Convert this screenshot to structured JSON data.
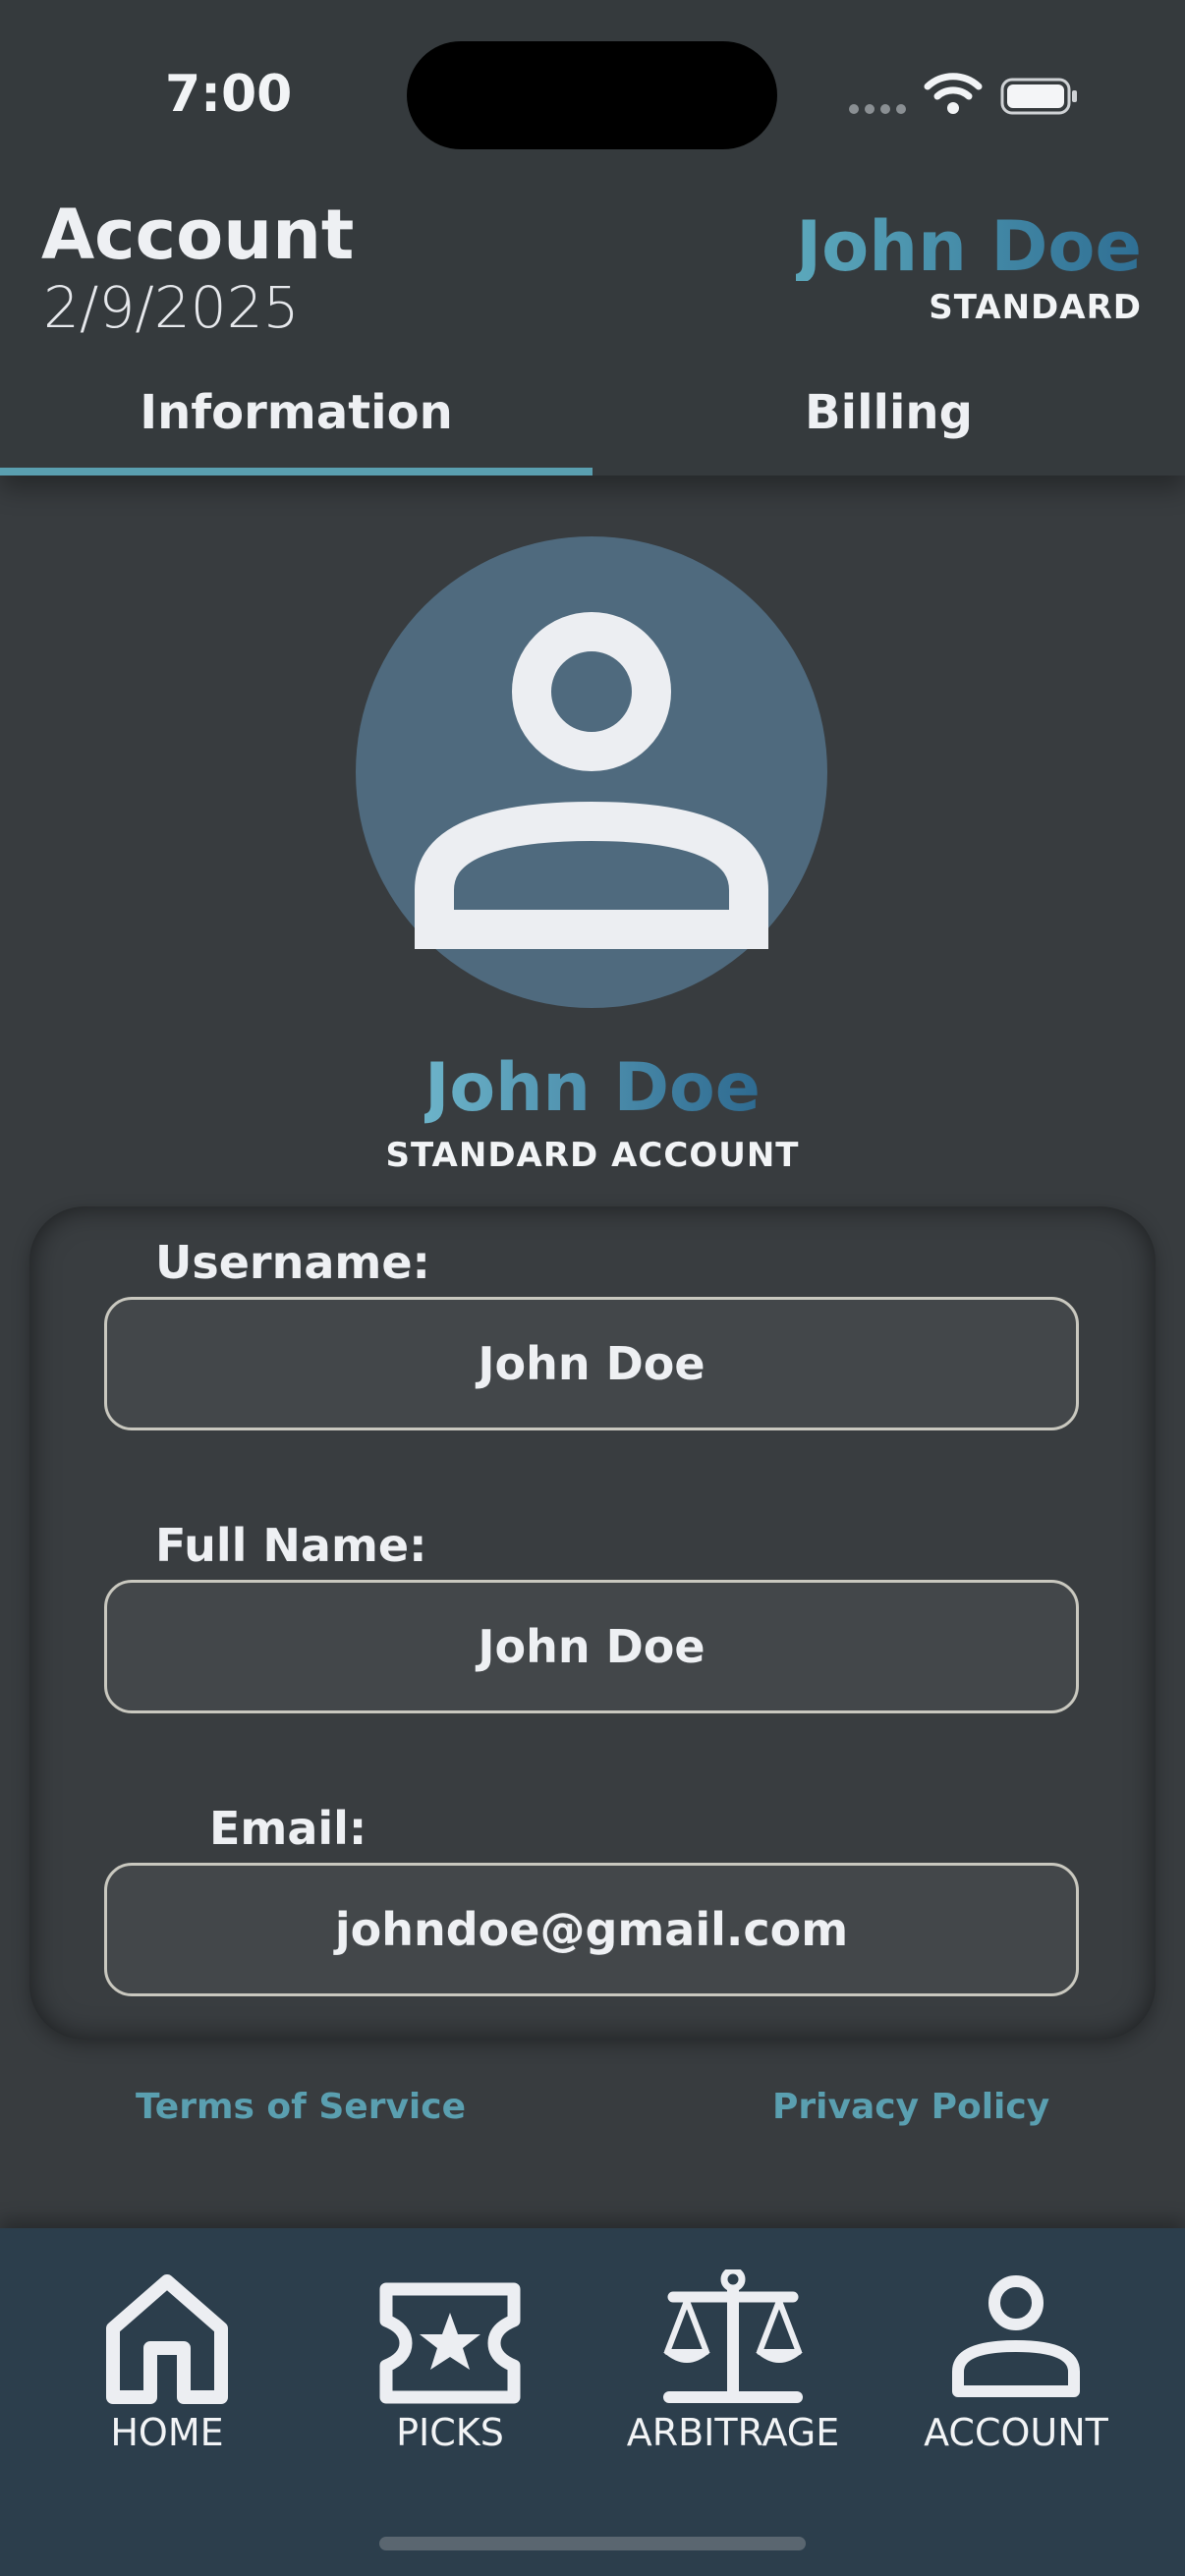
{
  "status_bar": {
    "time": "7:00"
  },
  "header": {
    "title": "Account",
    "date": "2/9/2025",
    "user_name": "John Doe",
    "tier": "STANDARD"
  },
  "tabs": [
    {
      "label": "Information",
      "active": true
    },
    {
      "label": "Billing",
      "active": false
    }
  ],
  "profile": {
    "name": "John Doe",
    "account_type": "STANDARD ACCOUNT"
  },
  "fields": {
    "username": {
      "label": "Username:",
      "value": "John Doe"
    },
    "full_name": {
      "label": "Full Name:",
      "value": "John Doe"
    },
    "email": {
      "label": "Email:",
      "value": "johndoe@gmail.com"
    }
  },
  "links": {
    "terms": "Terms of Service",
    "privacy": "Privacy Policy"
  },
  "nav": [
    {
      "label": "HOME",
      "icon": "home-icon"
    },
    {
      "label": "PICKS",
      "icon": "ticket-star-icon"
    },
    {
      "label": "ARBITRAGE",
      "icon": "scale-icon"
    },
    {
      "label": "ACCOUNT",
      "icon": "user-icon"
    }
  ],
  "colors": {
    "accent": "#5a9fb0",
    "background": "#383c3f",
    "nav_background": "#2c3e4c",
    "avatar_background": "#4f6a7e"
  }
}
